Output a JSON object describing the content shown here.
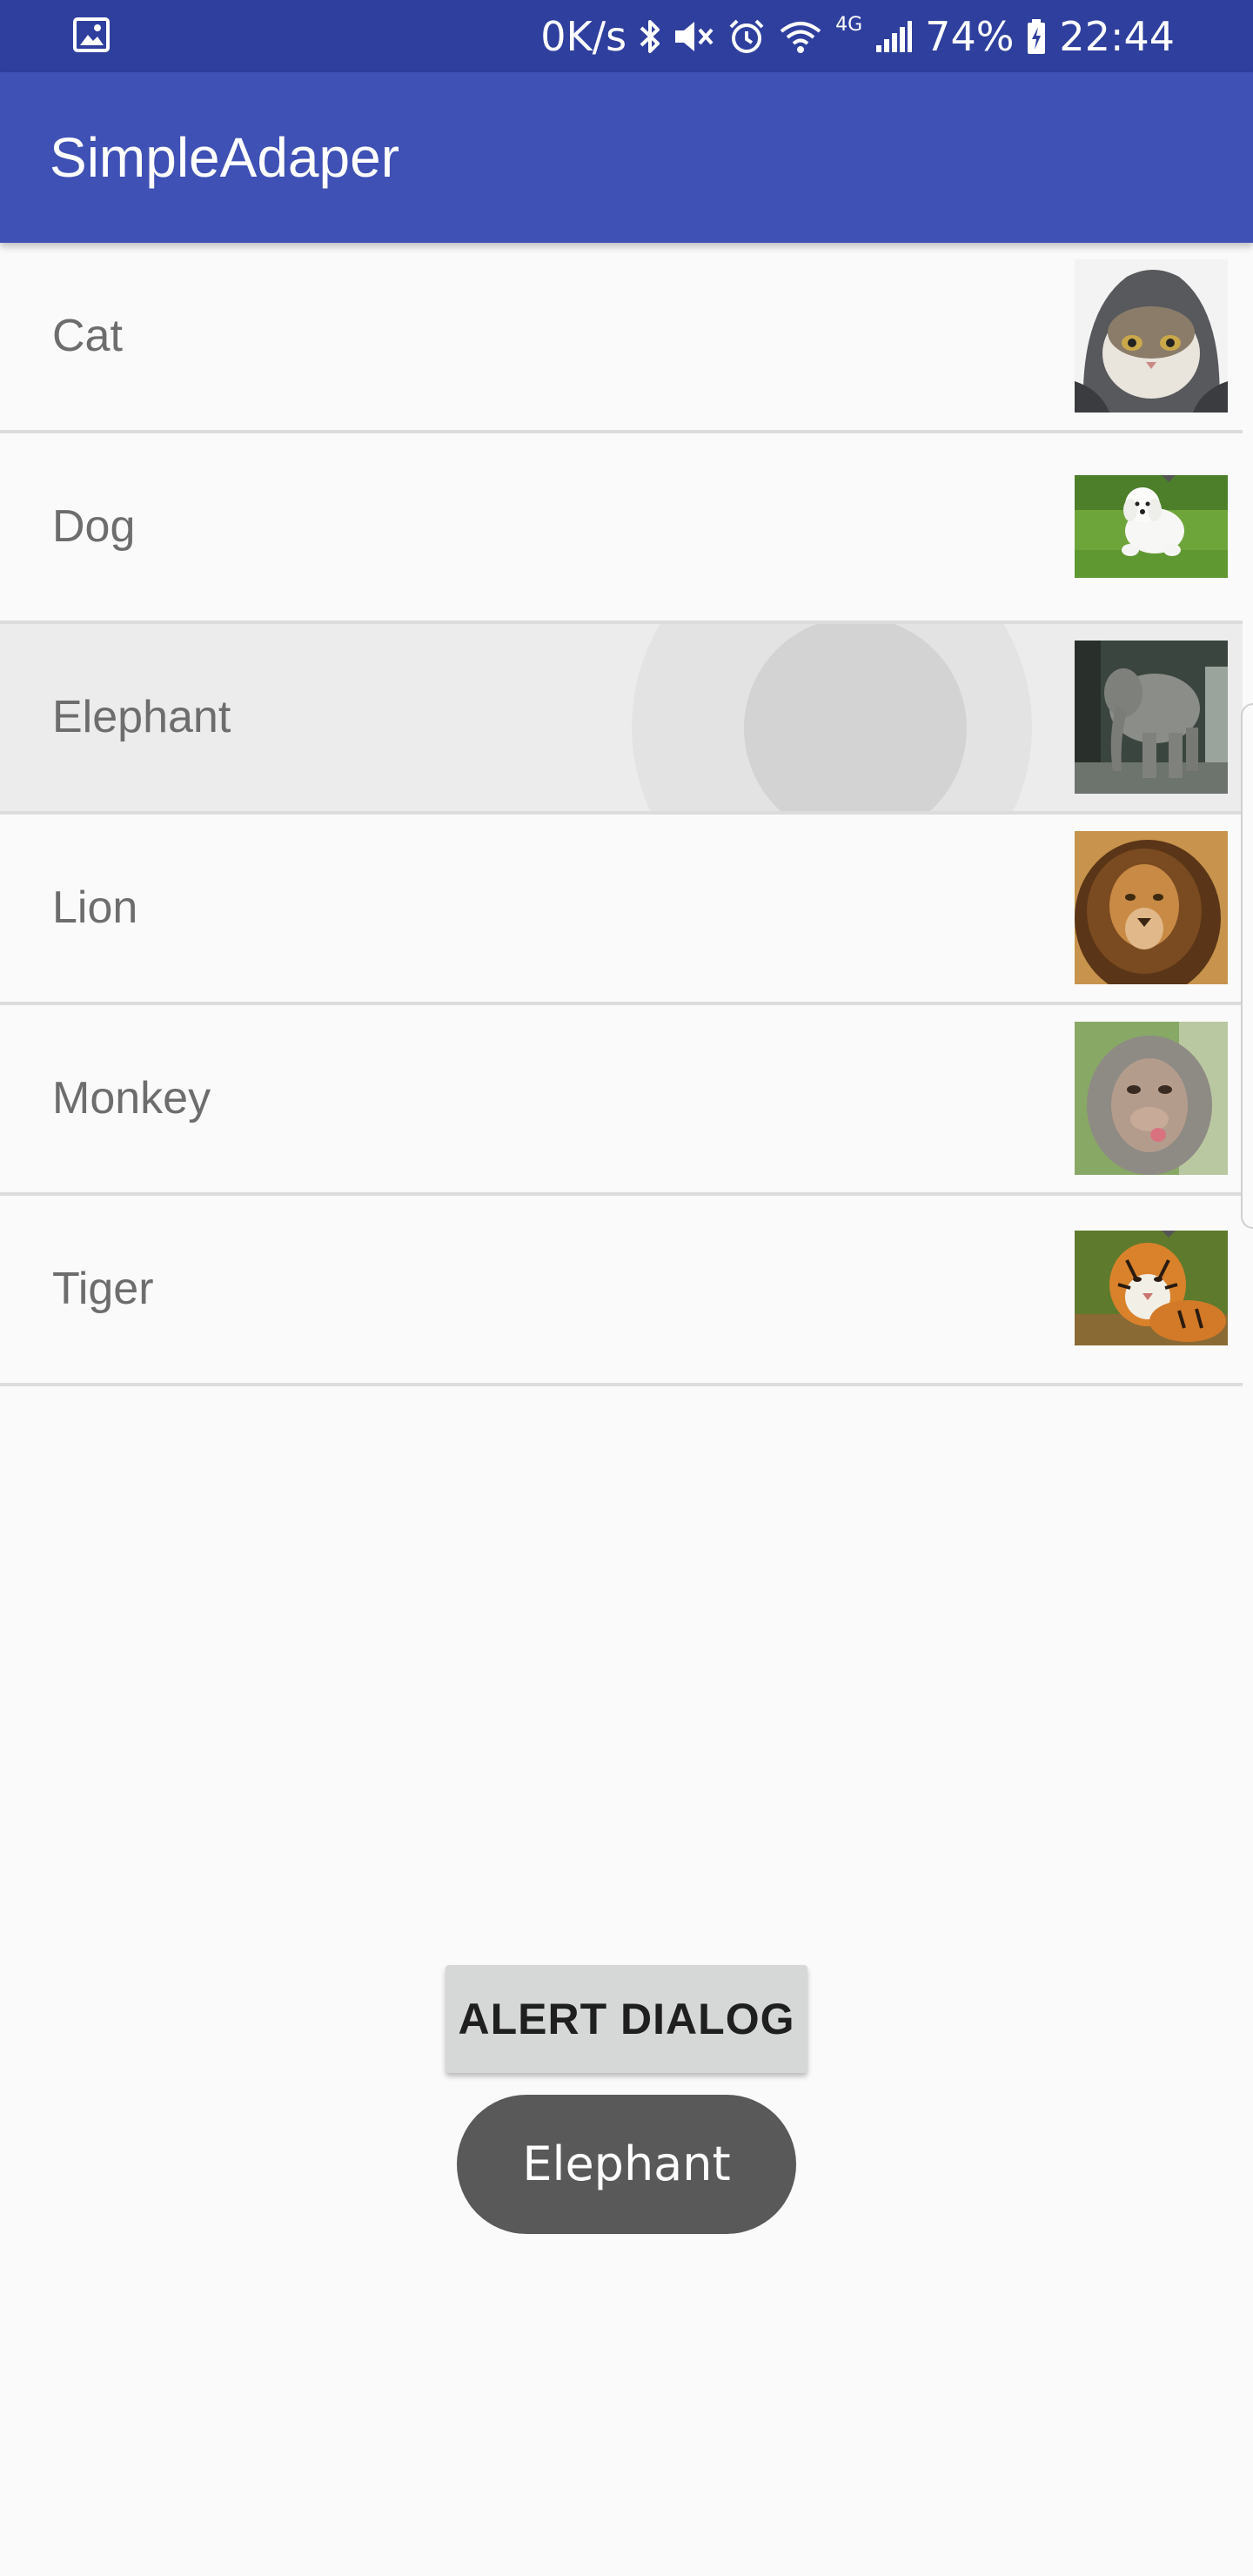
{
  "status_bar": {
    "gallery_icon": "image-icon",
    "network_speed": "0K/s",
    "icons": [
      "bluetooth-icon",
      "mute-icon",
      "alarm-icon",
      "wifi-icon",
      "4g-icon",
      "signal-icon"
    ],
    "network_type": "4G",
    "battery_percent": "74%",
    "battery_icon": "battery-charging-icon",
    "time": "22:44"
  },
  "app_bar": {
    "title": "SimpleAdaper"
  },
  "list": {
    "items": [
      {
        "label": "Cat",
        "image": "cat-photo"
      },
      {
        "label": "Dog",
        "image": "dog-photo"
      },
      {
        "label": "Elephant",
        "image": "elephant-photo",
        "pressed": true
      },
      {
        "label": "Lion",
        "image": "lion-photo"
      },
      {
        "label": "Monkey",
        "image": "monkey-photo"
      },
      {
        "label": "Tiger",
        "image": "tiger-photo"
      }
    ]
  },
  "alert_button": {
    "label": "ALERT DIALOG"
  },
  "toast": {
    "text": "Elephant"
  },
  "colors": {
    "status_bar": "#2f3f9e",
    "app_bar": "#3f51b5",
    "background": "#fafafa",
    "toast": "#595959"
  }
}
